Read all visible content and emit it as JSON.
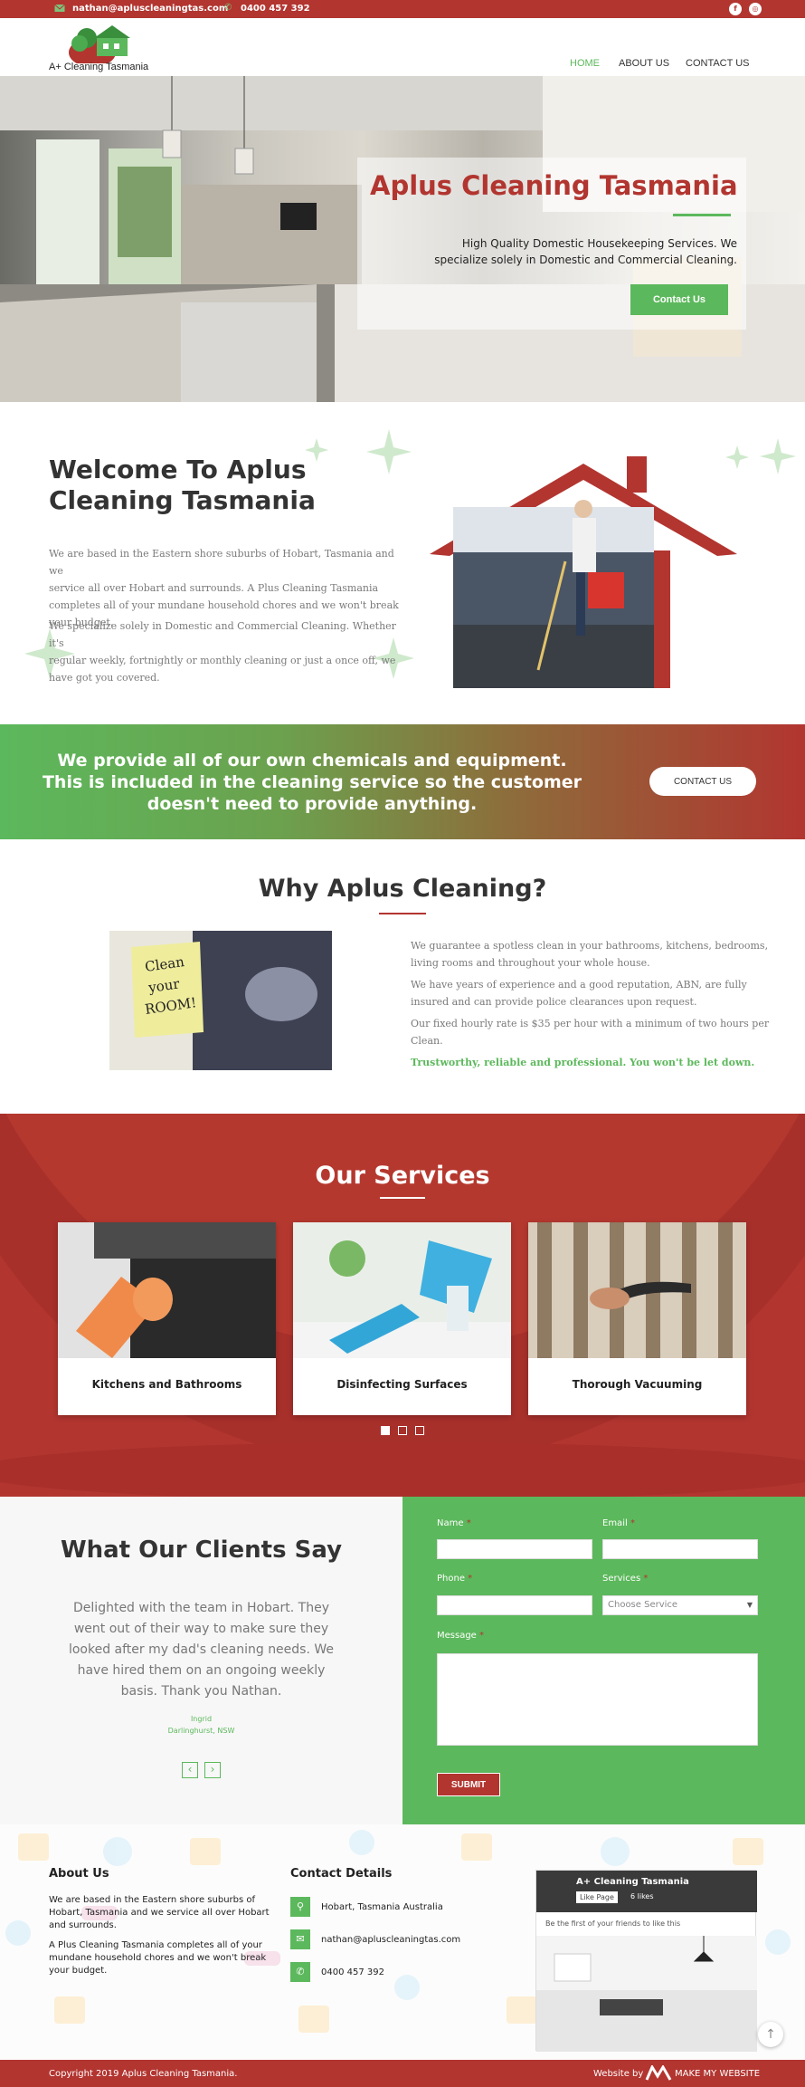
{
  "topbar": {
    "email": "nathan@apluscleaningtas.com",
    "phone": "0400 457 392"
  },
  "brand": {
    "name": "A+ Cleaning Tasmania",
    "accent": "#b23530",
    "green": "#5cb85c"
  },
  "nav": {
    "items": [
      "HOME",
      "ABOUT US",
      "CONTACT US"
    ],
    "active": "HOME"
  },
  "hero": {
    "title": "Aplus Cleaning Tasmania",
    "subtitle_line1": "High Quality Domestic Housekeeping Services. We",
    "subtitle_line2": "specialize solely in Domestic and Commercial Cleaning.",
    "cta": "Contact Us"
  },
  "welcome": {
    "heading_line1": "Welcome To Aplus",
    "heading_line2": "Cleaning Tasmania",
    "para1": [
      "We are based in the Eastern shore suburbs of Hobart, Tasmania and we",
      "service all over Hobart and surrounds. A Plus Cleaning Tasmania",
      "completes all of your mundane household chores and we won't break",
      "your budget."
    ],
    "para2": [
      "We specialize solely in Domestic and Commercial Cleaning. Whether it's",
      "regular weekly, fortnightly or monthly cleaning or just a once off, we",
      "have got you covered."
    ]
  },
  "banner": {
    "line1": "We provide all of our own chemicals and equipment.",
    "line2": "This is included in the cleaning service so the customer",
    "line3": "doesn't need to provide anything.",
    "button": "CONTACT US"
  },
  "why": {
    "heading": "Why Aplus Cleaning?",
    "note_text": "Clean your ROOM!",
    "p1": [
      "We guarantee a spotless clean in your bathrooms, kitchens, bedrooms,",
      "living rooms and throughout your whole house."
    ],
    "p2": [
      "We have years of experience and a good reputation, ABN, are fully",
      "insured and can provide police clearances upon request."
    ],
    "p3": [
      "Our fixed hourly rate is $35 per hour with a minimum of two hours per",
      "Clean."
    ],
    "tagline": "Trustworthy, reliable and professional. You won't be let down."
  },
  "services": {
    "heading": "Our Services",
    "items": [
      {
        "label": "Kitchens and Bathrooms"
      },
      {
        "label": "Disinfecting Surfaces"
      },
      {
        "label": "Thorough Vacuuming"
      }
    ]
  },
  "testimonials": {
    "heading": "What Our Clients Say",
    "quote": [
      "Delighted with the team in Hobart. They",
      "went out of their way to make sure they",
      "looked after my dad's cleaning needs. We",
      "have hired them on an ongoing weekly",
      "basis. Thank you Nathan."
    ],
    "author": "Ingrid",
    "location": "Darlinghurst, NSW",
    "prev": "‹",
    "next": "›"
  },
  "form": {
    "name_label": "Name",
    "email_label": "Email",
    "phone_label": "Phone",
    "services_label": "Services",
    "services_placeholder": "Choose Service",
    "message_label": "Message",
    "required": "*",
    "submit": "SUBMIT"
  },
  "footer": {
    "about_title": "About Us",
    "about_p1": [
      "We are based in the Eastern shore suburbs of",
      "Hobart, Tasmania and we service all over Hobart",
      "and surrounds."
    ],
    "about_p2": [
      "A Plus Cleaning Tasmania completes all of your",
      "mundane household chores and we won't break",
      "your budget."
    ],
    "contact_title": "Contact Details",
    "address": "Hobart, Tasmania Australia",
    "email": "nathan@apluscleaningtas.com",
    "phone": "0400 457 392",
    "fb_page_name": "A+ Cleaning Tasmania",
    "fb_like": "Like Page",
    "fb_likes": "6 likes",
    "fb_first": "Be the first of your friends to like this"
  },
  "copyright": {
    "text": "Copyright 2019 Aplus Cleaning Tasmania.",
    "credit_prefix": "Website by",
    "credit": "MAKE MY WEBSITE"
  }
}
